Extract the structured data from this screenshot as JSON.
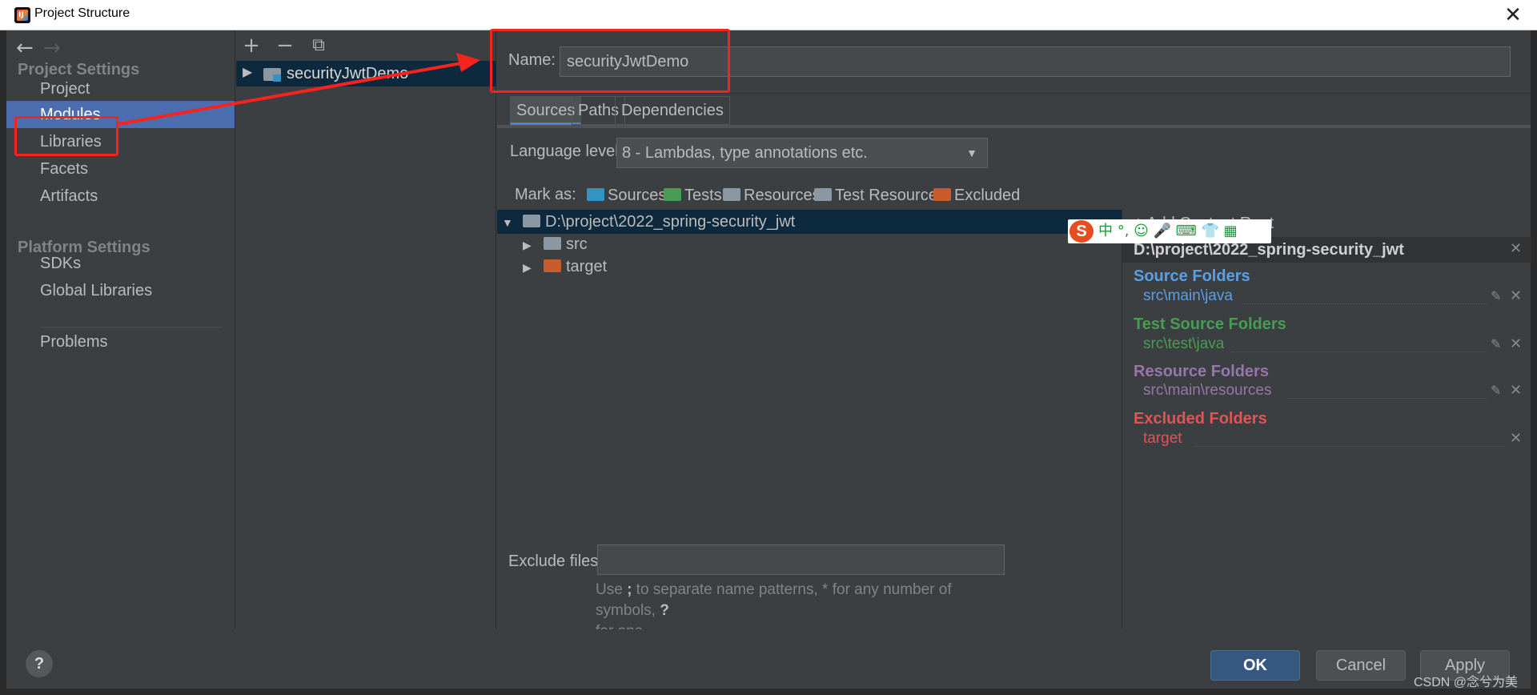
{
  "window": {
    "title": "Project Structure",
    "close": "✕"
  },
  "sidebar": {
    "back": "←",
    "forward": "→",
    "project_settings": "Project Settings",
    "platform_settings": "Platform Settings",
    "items": [
      {
        "label": "Project"
      },
      {
        "label": "Modules"
      },
      {
        "label": "Libraries"
      },
      {
        "label": "Facets"
      },
      {
        "label": "Artifacts"
      },
      {
        "label": "SDKs"
      },
      {
        "label": "Global Libraries"
      },
      {
        "label": "Problems"
      }
    ]
  },
  "modules": {
    "add": "+",
    "remove": "−",
    "copy": "⧉",
    "module_name": "securityJwtDemo"
  },
  "content": {
    "name_label": "Name:",
    "name_value": "securityJwtDemo",
    "tabs": [
      "Sources",
      "Paths",
      "Dependencies"
    ],
    "language_label": "Language level:",
    "language_value": "8 - Lambdas, type annotations etc.",
    "mark_as_label": "Mark as:",
    "mark_as": [
      {
        "label": "Sources",
        "color": "#3592c4"
      },
      {
        "label": "Tests",
        "color": "#499c54"
      },
      {
        "label": "Resources",
        "color": "#8b98a4"
      },
      {
        "label": "Test Resources",
        "color": "#8b98a4"
      },
      {
        "label": "Excluded",
        "color": "#c75b2c"
      }
    ],
    "tree": {
      "root": "D:\\project\\2022_spring-security_jwt",
      "children": [
        "src",
        "target"
      ]
    },
    "exclude_label": "Exclude files:",
    "hint_a": "Use ",
    "hint_b": ";",
    "hint_c": " to separate name patterns, * for any number of symbols, ",
    "hint_d": "?",
    "hint_e": "for one."
  },
  "roots": {
    "add_content_root": "+ Add Content Root",
    "root_path": "D:\\project\\2022_spring-security_jwt",
    "source_folders": {
      "title": "Source Folders",
      "item": "src\\main\\java",
      "color": "#5c9fe4"
    },
    "test_source_folders": {
      "title": "Test Source Folders",
      "item": "src\\test\\java",
      "color": "#499c54"
    },
    "resource_folders": {
      "title": "Resource Folders",
      "item": "src\\main\\resources",
      "color": "#9876aa"
    },
    "excluded_folders": {
      "title": "Excluded Folders",
      "item": "target",
      "color": "#e05454"
    }
  },
  "ime": {
    "brand": "S",
    "chars": "中 °, ☺ 🎤 ⌨ 👕 ▦"
  },
  "footer": {
    "help": "?",
    "ok": "OK",
    "cancel": "Cancel",
    "apply": "Apply"
  },
  "watermark": "CSDN @念兮为美"
}
